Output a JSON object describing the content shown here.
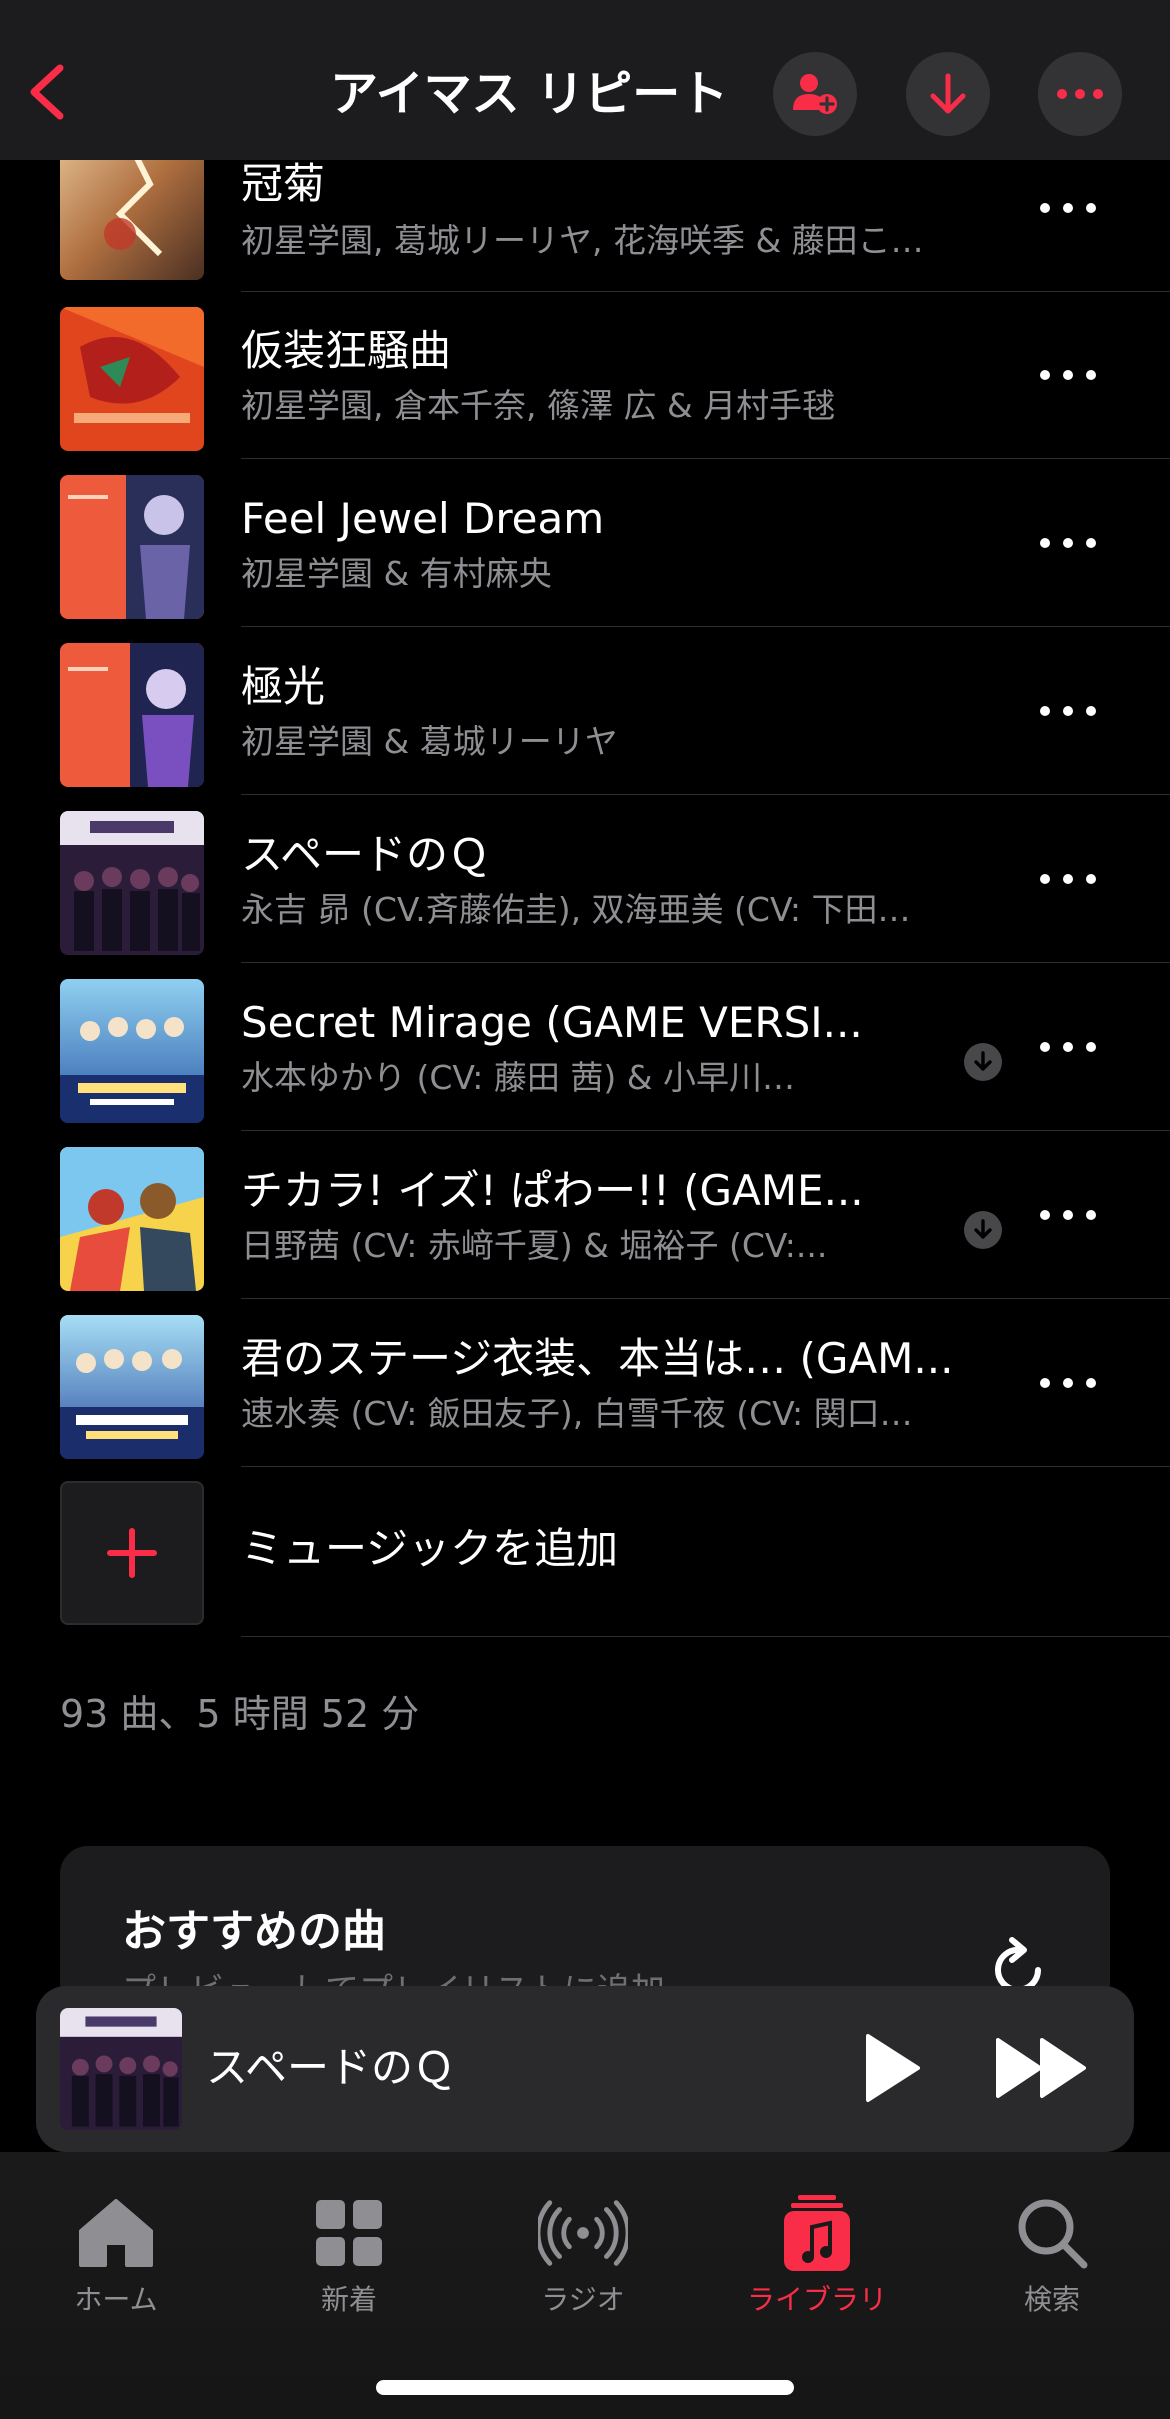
{
  "header": {
    "title": "アイマス リピート",
    "back_icon": "chevron-left-icon",
    "add_person_icon": "person-add-icon",
    "download_icon": "arrow-down-icon",
    "more_icon": "ellipsis-icon"
  },
  "songs": [
    {
      "title": "冠菊",
      "artist": "初星学園, 葛城リーリヤ, 花海咲季 & 藤田こ…",
      "downloaded": false
    },
    {
      "title": "仮装狂騒曲",
      "artist": "初星学園, 倉本千奈, 篠澤 広 & 月村手毬",
      "downloaded": false
    },
    {
      "title": "Feel Jewel Dream",
      "artist": "初星学園 & 有村麻央",
      "downloaded": false
    },
    {
      "title": "極光",
      "artist": "初星学園 & 葛城リーリヤ",
      "downloaded": false
    },
    {
      "title": "スペードのＱ",
      "artist": "永吉 昴 (CV.斉藤佑圭), 双海亜美 (CV: 下田…",
      "downloaded": false
    },
    {
      "title": "Secret Mirage (GAME VERSI...",
      "artist": "水本ゆかり (CV: 藤田 茜) & 小早川…",
      "downloaded": true
    },
    {
      "title": "チカラ! イズ! ぱわー!! (GAME...",
      "artist": "日野茜 (CV: 赤﨑千夏) & 堀裕子 (CV:...",
      "downloaded": true
    },
    {
      "title": "君のステージ衣装、本当は… (GAM...",
      "artist": "速水奏 (CV: 飯田友子), 白雪千夜 (CV: 関口…",
      "downloaded": false
    }
  ],
  "add_music": {
    "label": "ミュージックを追加"
  },
  "summary": "93 曲、5 時間 52 分",
  "recommendations": {
    "title": "おすすめの曲",
    "subtitle": "プレビューしてプレイリストに追加"
  },
  "mini_player": {
    "title": "スペードのＱ"
  },
  "tabs": [
    {
      "label": "ホーム",
      "icon": "home-icon",
      "active": false
    },
    {
      "label": "新着",
      "icon": "grid-icon",
      "active": false
    },
    {
      "label": "ラジオ",
      "icon": "radio-icon",
      "active": false
    },
    {
      "label": "ライブラリ",
      "icon": "music-library-icon",
      "active": true
    },
    {
      "label": "検索",
      "icon": "search-icon",
      "active": false
    }
  ],
  "colors": {
    "accent": "#fa2d48",
    "background": "#000000",
    "secondary_text": "#8e8e93"
  }
}
